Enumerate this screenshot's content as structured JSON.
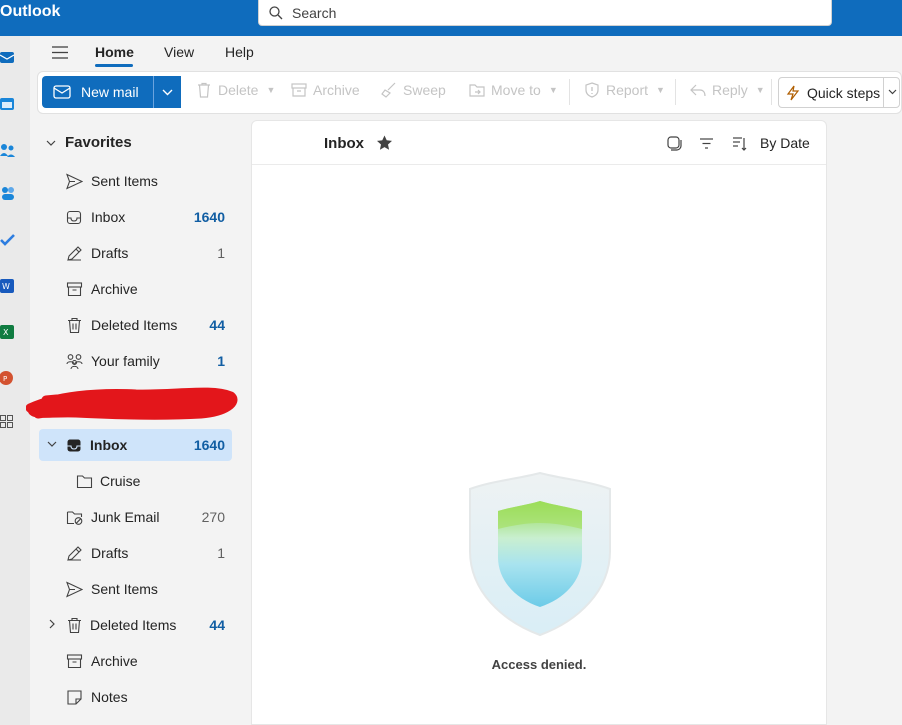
{
  "app": {
    "title": "Outlook"
  },
  "search": {
    "placeholder": "Search"
  },
  "tabs": [
    {
      "label": "Home",
      "active": true
    },
    {
      "label": "View"
    },
    {
      "label": "Help"
    }
  ],
  "ribbon": {
    "new_mail": "New mail",
    "delete": "Delete",
    "archive": "Archive",
    "sweep": "Sweep",
    "move_to": "Move to",
    "report": "Report",
    "reply": "Reply",
    "quick_steps": "Quick steps"
  },
  "favorites": {
    "header": "Favorites",
    "items": [
      {
        "label": "Sent Items",
        "icon": "send-icon",
        "count": ""
      },
      {
        "label": "Inbox",
        "icon": "inbox-icon",
        "count": "1640",
        "unread": true
      },
      {
        "label": "Drafts",
        "icon": "pencil-icon",
        "count": "1"
      },
      {
        "label": "Archive",
        "icon": "archive-icon",
        "count": ""
      },
      {
        "label": "Deleted Items",
        "icon": "trash-icon",
        "count": "44",
        "unread": true
      },
      {
        "label": "Your family",
        "icon": "people-icon",
        "count": "1",
        "unread": true
      }
    ]
  },
  "account_folders": [
    {
      "label": "Inbox",
      "icon": "inbox-icon",
      "count": "1640",
      "unread": true,
      "selected": true,
      "expanded": true
    },
    {
      "label": "Cruise",
      "icon": "folder-icon",
      "count": ""
    },
    {
      "label": "Junk Email",
      "icon": "junk-icon",
      "count": "270"
    },
    {
      "label": "Drafts",
      "icon": "pencil-icon",
      "count": "1"
    },
    {
      "label": "Sent Items",
      "icon": "send-icon",
      "count": ""
    },
    {
      "label": "Deleted Items",
      "icon": "trash-icon",
      "count": "44",
      "unread": true,
      "collapsed": true
    },
    {
      "label": "Archive",
      "icon": "archive-icon",
      "count": ""
    },
    {
      "label": "Notes",
      "icon": "note-icon",
      "count": ""
    }
  ],
  "message_list": {
    "title": "Inbox",
    "sort_label": "By Date",
    "empty_message": "Access denied."
  },
  "colors": {
    "brand": "#0f6cbd",
    "selected_bg": "#cfe4fa",
    "unread_count": "#115ea3",
    "redaction": "#e3161b"
  }
}
